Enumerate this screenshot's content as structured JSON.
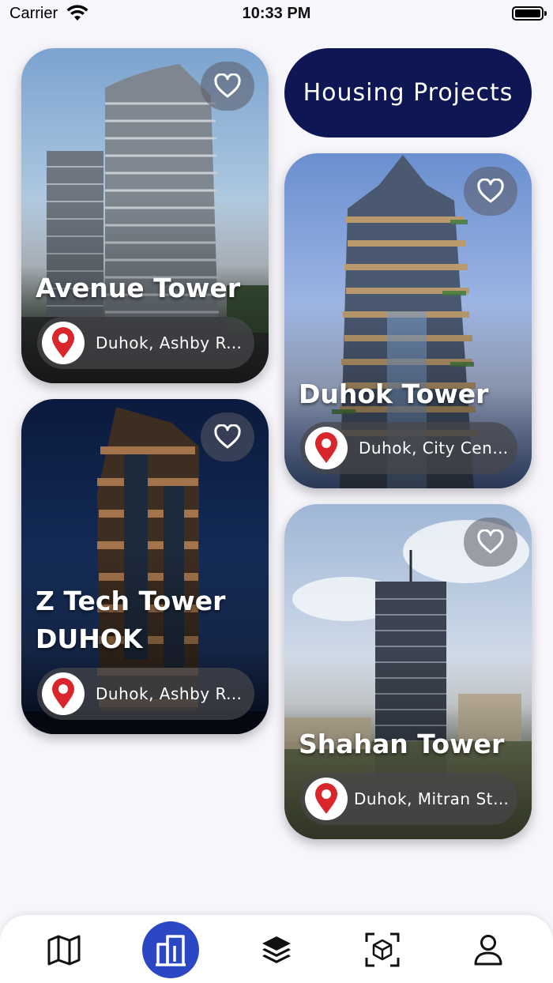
{
  "status_bar": {
    "carrier": "Carrier",
    "time": "10:33 PM"
  },
  "header": {
    "title": "Housing Projects"
  },
  "projects": [
    {
      "name": "Avenue Tower",
      "location": "Duhok, Ashby Road"
    },
    {
      "name": "Duhok Tower",
      "location": "Duhok, City Center"
    },
    {
      "name": "Z Tech Tower DUHOK",
      "location": "Duhok, Ashby Roa..."
    },
    {
      "name": "Shahan Tower",
      "location": "Duhok, Mitran Street"
    }
  ],
  "tabs": [
    {
      "icon": "map-icon",
      "active": false
    },
    {
      "icon": "buildings-icon",
      "active": true
    },
    {
      "icon": "layers-icon",
      "active": false
    },
    {
      "icon": "ar-cube-icon",
      "active": false
    },
    {
      "icon": "profile-icon",
      "active": false
    }
  ],
  "colors": {
    "accent": "#0e1754",
    "active_tab": "#2b47c3",
    "pin": "#d9262c"
  }
}
